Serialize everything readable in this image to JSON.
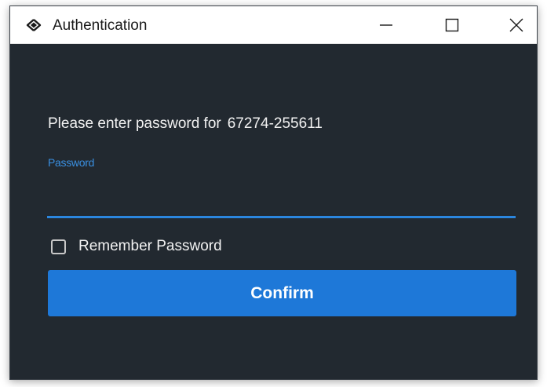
{
  "window": {
    "title": "Authentication",
    "app_icon": "double-ring-logo-icon",
    "controls": {
      "minimize_icon": "minimize-icon",
      "maximize_icon": "maximize-icon",
      "close_icon": "close-icon"
    }
  },
  "form": {
    "prompt_text": "Please enter password for",
    "account_id": "67274-255611",
    "password_label": "Password",
    "password_value": "",
    "remember_label": "Remember Password",
    "remember_checked": false,
    "confirm_label": "Confirm"
  },
  "colors": {
    "background": "#222930",
    "accent": "#1e78d8",
    "label_accent": "#3a8fe0",
    "text": "#f2f2f2"
  }
}
